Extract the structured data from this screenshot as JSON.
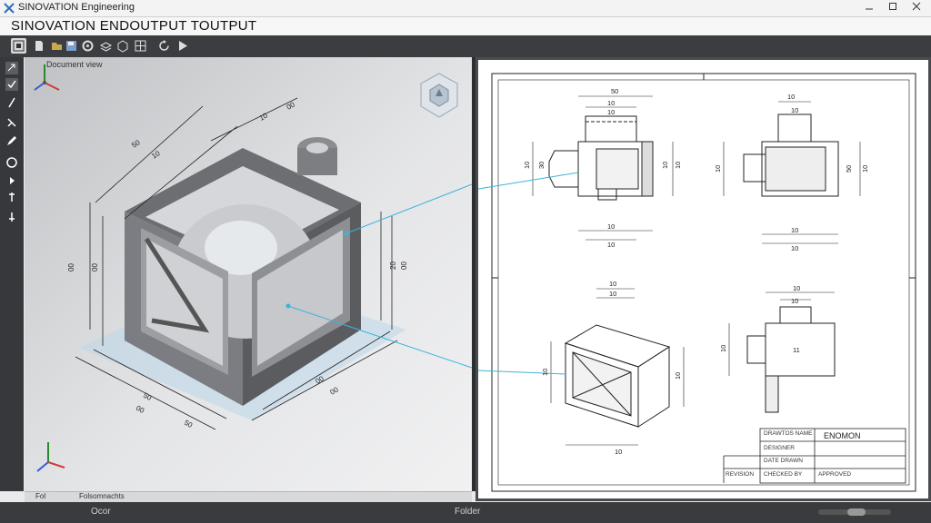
{
  "window": {
    "title": "SINOVATION Engineering",
    "controls": [
      "minimize",
      "maximize",
      "close"
    ]
  },
  "header": {
    "app_title": "SINOVATION ENDOUTPUT TOUTPUT"
  },
  "toolbar": {
    "icons": [
      "select-icon",
      "new-icon",
      "open-icon",
      "save-icon",
      "gear-icon",
      "layers-icon",
      "grid-icon",
      "rotate-icon",
      "play-icon"
    ]
  },
  "left_tools": {
    "icons": [
      "arrow-icon",
      "check-icon",
      "line-icon",
      "pen-icon",
      "circle-icon",
      "arrow-small-icon",
      "dimension-icon"
    ]
  },
  "viewport": {
    "label": "Document view"
  },
  "model_dims": {
    "top_a": "50",
    "top_b": "10",
    "top_c": "10",
    "top_d": "00",
    "left_a": "00",
    "left_b": "00",
    "right_a": "20",
    "right_b": "00",
    "bottom_a": "50",
    "bottom_b": "00",
    "bottom_c": "00",
    "bottom_d": "00",
    "bottom_e": "50"
  },
  "views": {
    "front": {
      "top1": "50",
      "top2": "10",
      "top3": "10",
      "left1": "10",
      "left2": "30",
      "right1": "10",
      "right2": "10",
      "bottom1": "10",
      "bottom2": "10"
    },
    "side": {
      "top1": "10",
      "top2": "10",
      "left": "10",
      "right1": "50",
      "right2": "10",
      "bottom1": "10",
      "bottom2": "10"
    },
    "iso": {
      "top1": "10",
      "top2": "10",
      "left": "10",
      "right": "10",
      "bottom": "10"
    },
    "side2": {
      "top1": "10",
      "top2": "10",
      "left": "10",
      "note": "11"
    }
  },
  "title_block": {
    "title": "ENOMON",
    "row1": "DRAWTOS NAME",
    "row2": "DESIGNER",
    "row3": "DATE DRAWN",
    "row4": "REVISION",
    "row5": "CHECKED BY",
    "row6": "APPROVED"
  },
  "statusbar": {
    "left": "Fol",
    "middle": "Folsomnachts",
    "right": ""
  },
  "bottombar": {
    "left": "Ocor",
    "center": "Folder"
  },
  "colors": {
    "accent_line": "#3db4d6",
    "toolbar_bg": "#3c3d40",
    "sheet": "#ffffff"
  }
}
